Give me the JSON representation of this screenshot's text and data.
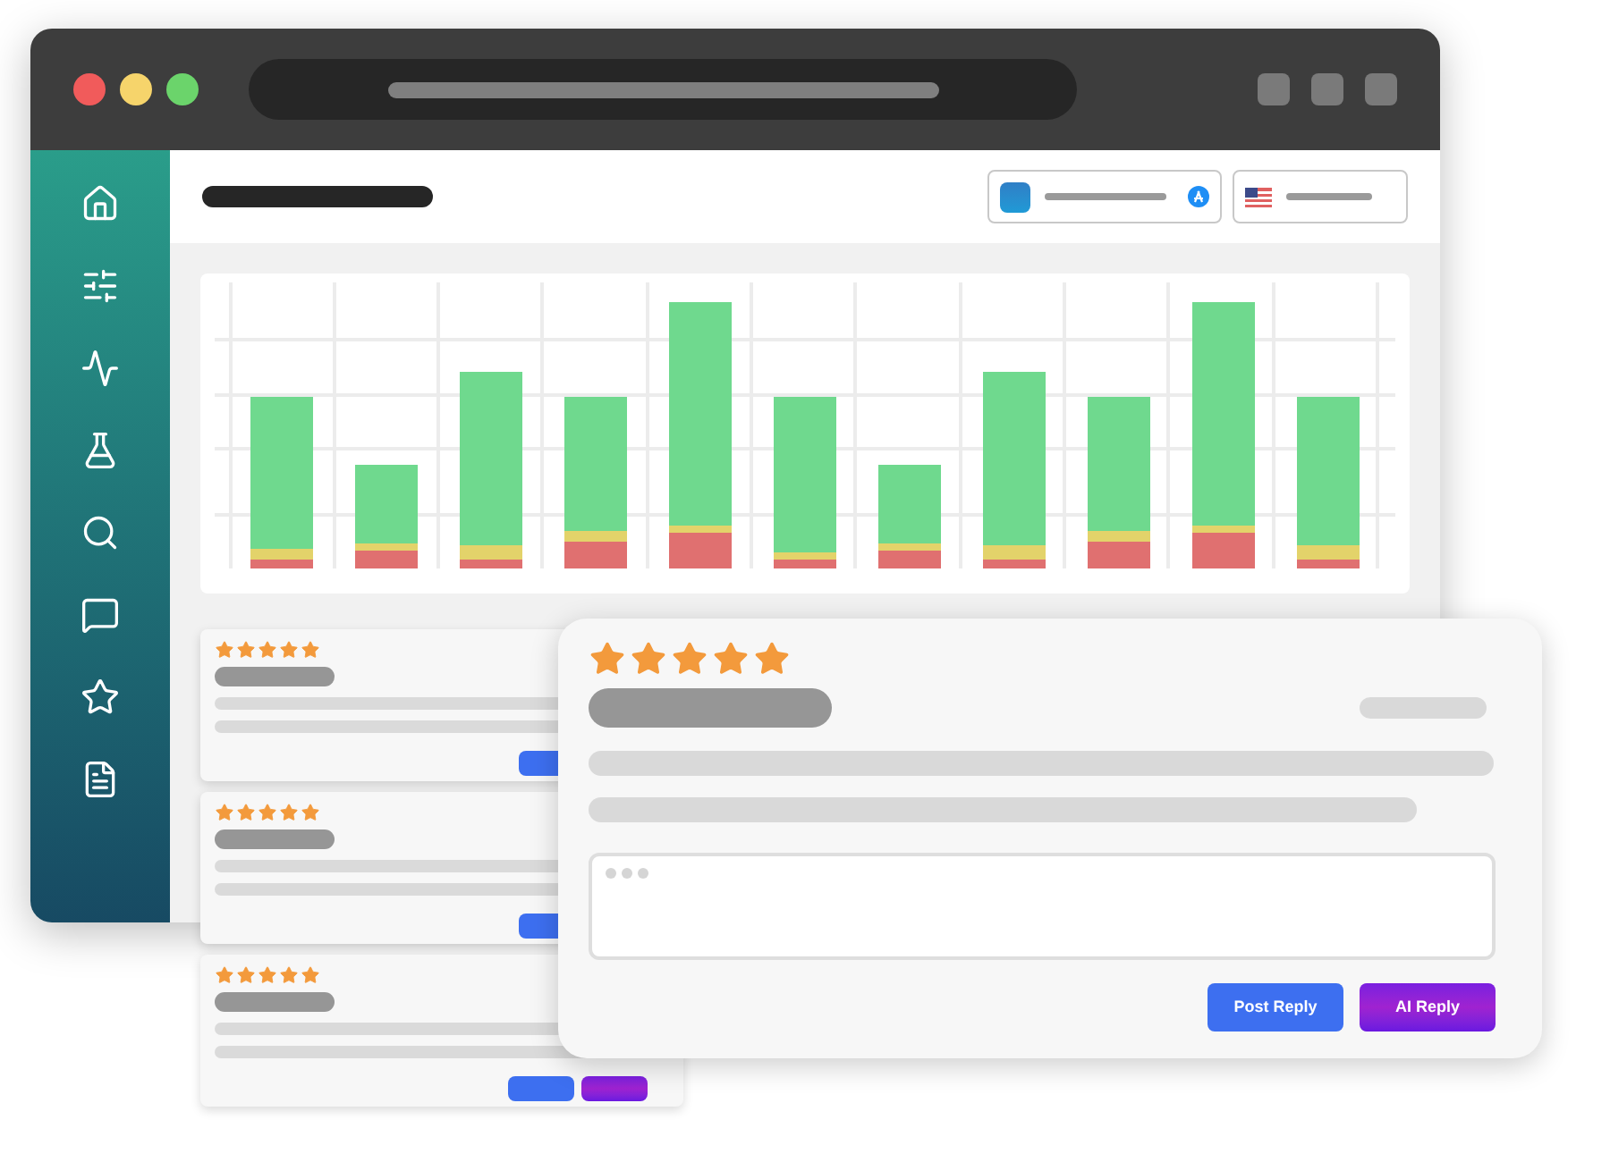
{
  "review_cards": [
    {
      "stars": 5
    },
    {
      "stars": 5
    },
    {
      "stars": 5
    }
  ],
  "reply_panel": {
    "stars": 5,
    "buttons": [
      {
        "label": "Post Reply",
        "kind": "post"
      },
      {
        "label": "AI Reply",
        "kind": "ai"
      }
    ]
  }
}
